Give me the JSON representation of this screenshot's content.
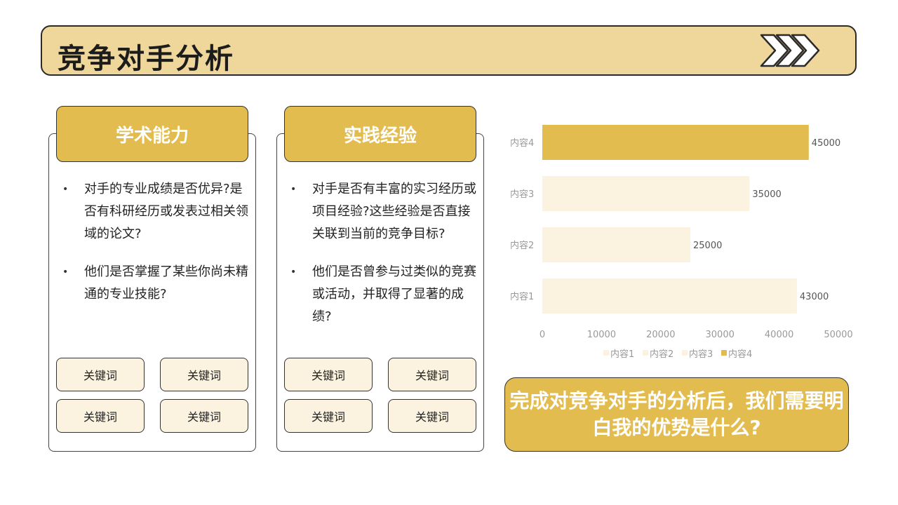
{
  "title": "竞争对手分析",
  "colors": {
    "accent": "#e3bc4f",
    "title_bg": "#efd79b",
    "light_bar": "#fbf3df",
    "keyword_bg": "#fbf3df"
  },
  "cards": [
    {
      "heading": "学术能力",
      "bullets": [
        "对手的专业成绩是否优异?是否有科研经历或发表过相关领域的论文?",
        "他们是否掌握了某些你尚未精通的专业技能?"
      ],
      "keywords": [
        "关键词",
        "关键词",
        "关键词",
        "关键词"
      ]
    },
    {
      "heading": "实践经验",
      "bullets": [
        "对手是否有丰富的实习经历或项目经验?这些经验是否直接关联到当前的竞争目标?",
        "他们是否曾参与过类似的竞赛或活动，并取得了显著的成绩?"
      ],
      "keywords": [
        "关键词",
        "关键词",
        "关键词",
        "关键词"
      ]
    }
  ],
  "chart_data": {
    "type": "bar",
    "orientation": "horizontal",
    "categories": [
      "内容1",
      "内容2",
      "内容3",
      "内容4"
    ],
    "values": [
      43000,
      25000,
      35000,
      45000
    ],
    "data_labels": [
      "43000",
      "25000",
      "35000",
      "45000"
    ],
    "xlim": [
      0,
      50000
    ],
    "ticks": [
      0,
      10000,
      20000,
      30000,
      40000,
      50000
    ],
    "tick_labels": [
      "0",
      "10000",
      "20000",
      "30000",
      "40000",
      "50000"
    ],
    "legend": [
      "内容1",
      "内容2",
      "内容3",
      "内容4"
    ],
    "legend_position": "bottom",
    "bar_colors": [
      "#fbf3df",
      "#fbf3df",
      "#fbf3df",
      "#e3bc4f"
    ],
    "grid": false
  },
  "callout": "完成对竞争对手的分析后，我们需要明白我的优势是什么?"
}
